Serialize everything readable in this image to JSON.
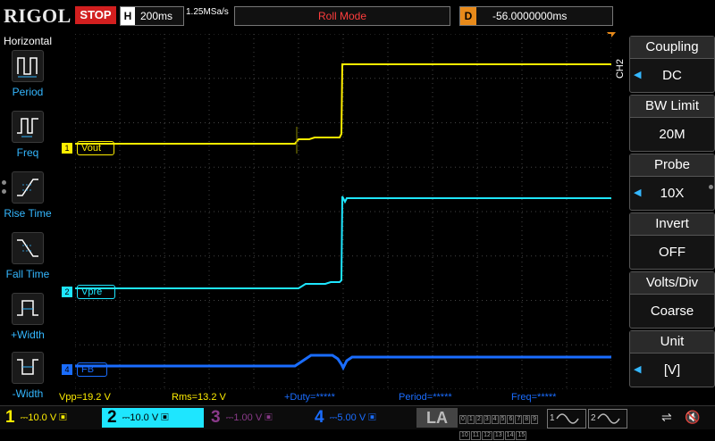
{
  "header": {
    "brand": "RIGOL",
    "run_state": "STOP",
    "timebase_letter": "H",
    "timebase": "200ms",
    "sample_rate": "1.25MSa/s",
    "trigger_mode": "Roll Mode",
    "delay_letter": "D",
    "delay": "-56.0000000ms"
  },
  "left_panel": {
    "title": "Horizontal",
    "items": [
      {
        "label": "Period",
        "icon": "period-icon"
      },
      {
        "label": "Freq",
        "icon": "freq-icon"
      },
      {
        "label": "Rise Time",
        "icon": "rise-time-icon"
      },
      {
        "label": "Fall Time",
        "icon": "fall-time-icon"
      },
      {
        "label": "+Width",
        "icon": "pos-width-icon"
      },
      {
        "label": "-Width",
        "icon": "neg-width-icon"
      }
    ]
  },
  "channels": [
    {
      "num": "1",
      "name": "Vout",
      "color": "#ffee00"
    },
    {
      "num": "2",
      "name": "Vpre",
      "color": "#1ee6ff"
    },
    {
      "num": "4",
      "name": "FB",
      "color": "#1a6dff"
    }
  ],
  "right_panel": {
    "channel_tag": "CH2",
    "menus": [
      {
        "title": "Coupling",
        "value": "DC",
        "arrow": true
      },
      {
        "title": "BW Limit",
        "value": "20M",
        "arrow": false
      },
      {
        "title": "Probe",
        "value": "10X",
        "arrow": true
      },
      {
        "title": "Invert",
        "value": "OFF",
        "arrow": false
      },
      {
        "title": "Volts/Div",
        "value": "Coarse",
        "arrow": false
      },
      {
        "title": "Unit",
        "value": "[V]",
        "arrow": true
      }
    ]
  },
  "measurements": {
    "vpp": "Vpp=19.2 V",
    "rms": "Rms=13.2 V",
    "duty": "+Duty=*****",
    "period": "Period=*****",
    "freq": "Freq=*****"
  },
  "bottom": {
    "ch1": {
      "num": "1",
      "scale": "10.0 V",
      "color": "#ffee00"
    },
    "ch2": {
      "num": "2",
      "scale": "10.0 V",
      "color": "#1ee6ff"
    },
    "ch3": {
      "num": "3",
      "scale": "1.00 V",
      "color": "#c63cc6"
    },
    "ch4": {
      "num": "4",
      "scale": "5.00 V",
      "color": "#1a6dff"
    },
    "la": "LA",
    "la_bits": [
      "0",
      "1",
      "2",
      "3",
      "4",
      "5",
      "6",
      "7",
      "8",
      "9",
      "10",
      "11",
      "12",
      "13",
      "14",
      "15"
    ],
    "wave1": "1",
    "wave2": "2"
  }
}
